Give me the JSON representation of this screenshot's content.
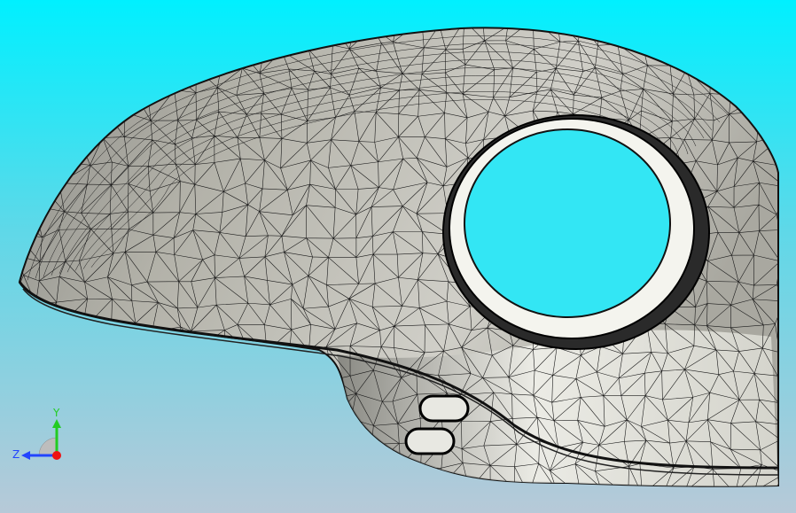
{
  "viewport": {
    "background_top": "#00f0ff",
    "background_bottom": "#b7c9d8"
  },
  "model": {
    "fill": "#b7b6ad",
    "highlight": "#f4f4ee",
    "mesh_color": "#1a1a1a"
  },
  "triad": {
    "y_label": "Y",
    "z_label": "Z",
    "y_color": "#22cc22",
    "z_color": "#2244ff",
    "origin_color": "#ee1111"
  }
}
